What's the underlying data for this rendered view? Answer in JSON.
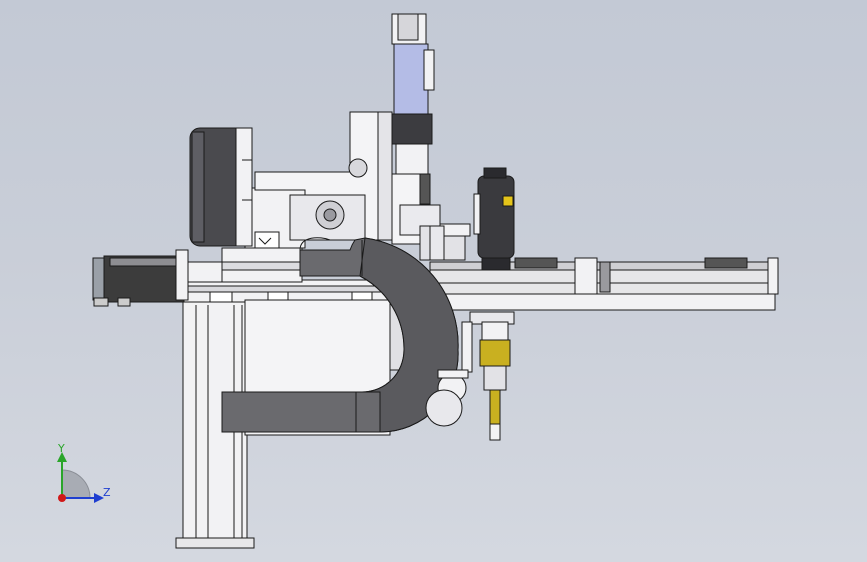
{
  "viewport": {
    "background_top": "#c3c9d5",
    "background_bottom": "#d4d8e0"
  },
  "triad": {
    "y_label": "Y",
    "z_label": "Z",
    "y_color": "#2aa52a",
    "z_color": "#1f3fd0",
    "origin_color": "#d01818"
  },
  "model": {
    "line_color": "#1a1a1a",
    "body_color": "#f2f2f4",
    "shade_color": "#d8d8dc",
    "cable_carrier_color": "#6a6a6a",
    "motor_color": "#3c3c3c",
    "tool_color": "#c9b020",
    "panel_color": "#b4bce6"
  }
}
